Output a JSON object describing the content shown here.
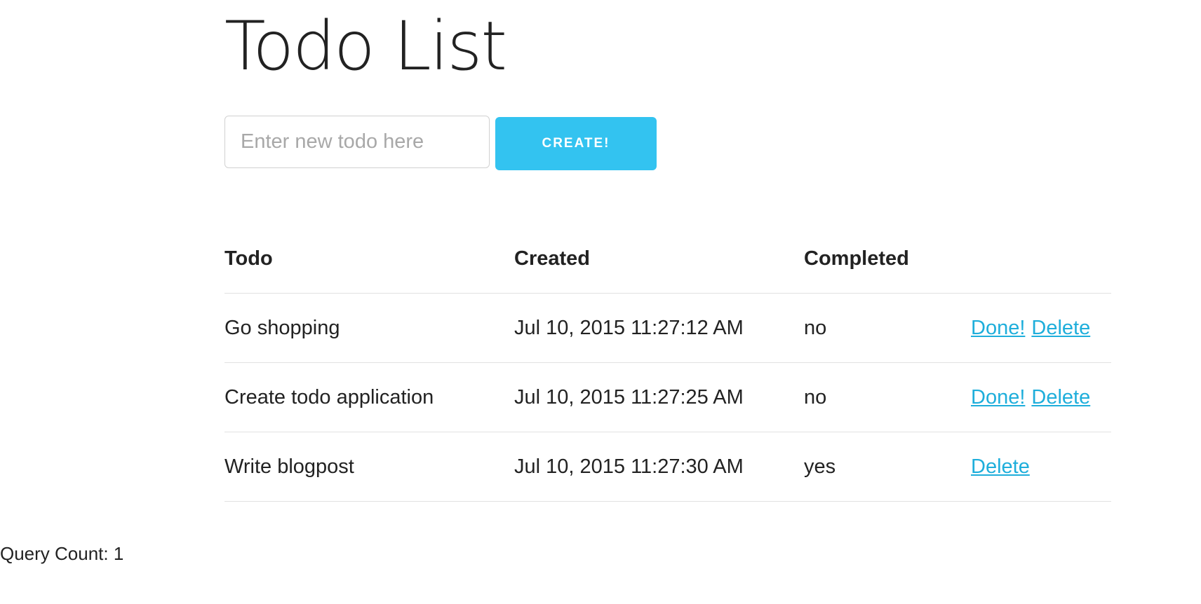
{
  "page": {
    "title": "Todo List"
  },
  "form": {
    "input_placeholder": "Enter new todo here",
    "input_value": "",
    "create_label": "CREATE!"
  },
  "table": {
    "headers": [
      "Todo",
      "Created",
      "Completed",
      ""
    ],
    "rows": [
      {
        "todo": "Go shopping",
        "created": "Jul 10, 2015 11:27:12 AM",
        "completed": "no",
        "done_label": "Done!",
        "delete_label": "Delete"
      },
      {
        "todo": "Create todo application",
        "created": "Jul 10, 2015 11:27:25 AM",
        "completed": "no",
        "done_label": "Done!",
        "delete_label": "Delete"
      },
      {
        "todo": "Write blogpost",
        "created": "Jul 10, 2015 11:27:30 AM",
        "completed": "yes",
        "done_label": null,
        "delete_label": "Delete"
      }
    ]
  },
  "footer": {
    "query_count": "Query Count: 1"
  },
  "colors": {
    "accent": "#33c3f0",
    "link": "#1eaedb",
    "text": "#222222",
    "border": "#e1e1e1"
  }
}
